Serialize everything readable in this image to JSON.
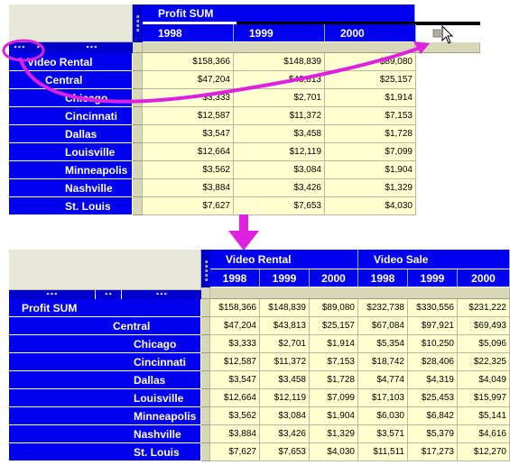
{
  "top": {
    "measure": "Profit SUM",
    "years": [
      "1998",
      "1999",
      "2000"
    ],
    "dots": [
      "∘∘∘",
      "∘∘",
      "∘∘∘"
    ],
    "rows": [
      {
        "label": "Video Rental",
        "values": [
          "$158,366",
          "$148,839",
          "$89,080"
        ]
      },
      {
        "label": "Central",
        "values": [
          "$47,204",
          "$43,813",
          "$25,157"
        ]
      },
      {
        "label": "Chicago",
        "values": [
          "$3,333",
          "$2,701",
          "$1,914"
        ]
      },
      {
        "label": "Cincinnati",
        "values": [
          "$12,587",
          "$11,372",
          "$7,153"
        ]
      },
      {
        "label": "Dallas",
        "values": [
          "$3,547",
          "$3,458",
          "$1,728"
        ]
      },
      {
        "label": "Louisville",
        "values": [
          "$12,664",
          "$12,119",
          "$7,099"
        ]
      },
      {
        "label": "Minneapolis",
        "values": [
          "$3,562",
          "$3,084",
          "$1,904"
        ]
      },
      {
        "label": "Nashville",
        "values": [
          "$3,884",
          "$3,426",
          "$1,329"
        ]
      },
      {
        "label": "St. Louis",
        "values": [
          "$7,627",
          "$7,653",
          "$4,030"
        ]
      }
    ]
  },
  "bottom": {
    "groups": [
      "Video Rental",
      "Video Sale"
    ],
    "years": [
      "1998",
      "1999",
      "2000",
      "1998",
      "1999",
      "2000"
    ],
    "dots": [
      "∘∘∘",
      "∘∘",
      "∘∘∘"
    ],
    "rows": [
      {
        "label": "Profit SUM",
        "values": [
          "$158,366",
          "$148,839",
          "$89,080",
          "$232,738",
          "$330,556",
          "$231,222"
        ]
      },
      {
        "label": "Central",
        "values": [
          "$47,204",
          "$43,813",
          "$25,157",
          "$67,084",
          "$97,921",
          "$69,493"
        ]
      },
      {
        "label": "Chicago",
        "values": [
          "$3,333",
          "$2,701",
          "$1,914",
          "$5,354",
          "$10,250",
          "$5,096"
        ]
      },
      {
        "label": "Cincinnati",
        "values": [
          "$12,587",
          "$11,372",
          "$7,153",
          "$18,742",
          "$28,406",
          "$22,325"
        ]
      },
      {
        "label": "Dallas",
        "values": [
          "$3,547",
          "$3,458",
          "$1,728",
          "$4,774",
          "$4,319",
          "$4,049"
        ]
      },
      {
        "label": "Louisville",
        "values": [
          "$12,664",
          "$12,119",
          "$7,099",
          "$17,103",
          "$25,453",
          "$15,997"
        ]
      },
      {
        "label": "Minneapolis",
        "values": [
          "$3,562",
          "$3,084",
          "$1,904",
          "$6,030",
          "$6,842",
          "$5,141"
        ]
      },
      {
        "label": "Nashville",
        "values": [
          "$3,884",
          "$3,426",
          "$1,329",
          "$3,571",
          "$5,379",
          "$4,616"
        ]
      },
      {
        "label": "St. Louis",
        "values": [
          "$7,627",
          "$7,653",
          "$4,030",
          "$11,511",
          "$17,273",
          "$12,270"
        ]
      }
    ]
  },
  "colors": {
    "header_blue": "#0000ee",
    "data_cell": "#ffffd0",
    "annotation": "#e020e0"
  },
  "icons": [
    "grip-dots-icon",
    "mouse-cursor-icon",
    "curved-arrow-icon",
    "down-arrow-icon"
  ]
}
